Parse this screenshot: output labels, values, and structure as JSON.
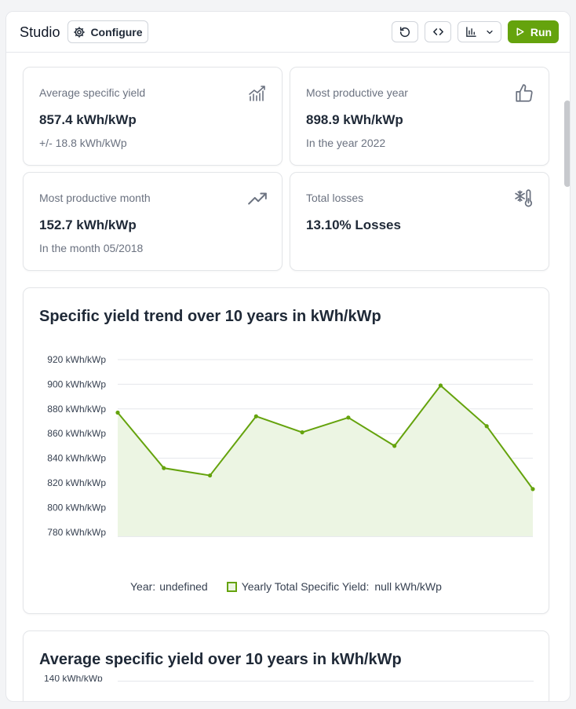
{
  "app": {
    "title": "Studio",
    "configure_label": "Configure",
    "run_label": "Run"
  },
  "stats": [
    {
      "label": "Average specific yield",
      "value": "857.4 kWh/kWp",
      "sub": "+/- 18.8 kWh/kWp",
      "icon": "bar-trend-icon"
    },
    {
      "label": "Most productive year",
      "value": "898.9 kWh/kWp",
      "sub": "In the year 2022",
      "icon": "thumbs-up-icon"
    },
    {
      "label": "Most productive month",
      "value": "152.7 kWh/kWp",
      "sub": "In the month 05/2018",
      "icon": "trending-up-icon"
    },
    {
      "label": "Total losses",
      "value": "13.10% Losses",
      "sub": "",
      "icon": "thermometer-snow-icon"
    }
  ],
  "trend_chart": {
    "title": "Specific yield trend over 10 years in kWh/kWp",
    "legend": {
      "x_key": "Year:",
      "x_value": "undefined",
      "series_key": "Yearly Total Specific Yield:",
      "series_value": "null kWh/kWp"
    }
  },
  "avg_chart": {
    "title": "Average specific yield over 10 years in kWh/kWp",
    "first_tick": "140 kWh/kWp"
  },
  "colors": {
    "accent": "#65a30d",
    "area_fill": "#ecf5e3"
  },
  "chart_data": [
    {
      "type": "area",
      "title": "Specific yield trend over 10 years in kWh/kWp",
      "y_ticks": [
        "920 kWh/kWp",
        "900 kWh/kWp",
        "880 kWh/kWp",
        "860 kWh/kWp",
        "840 kWh/kWp",
        "820 kWh/kWp",
        "800 kWh/kWp",
        "780 kWh/kWp"
      ],
      "ylim": [
        778,
        925
      ],
      "x": [
        1,
        2,
        3,
        4,
        5,
        6,
        7,
        8,
        9,
        10
      ],
      "series": [
        {
          "name": "Yearly Total Specific Yield",
          "values": [
            877,
            832,
            826,
            874,
            861,
            873,
            850,
            899,
            866,
            815
          ]
        }
      ],
      "grid": true
    }
  ]
}
